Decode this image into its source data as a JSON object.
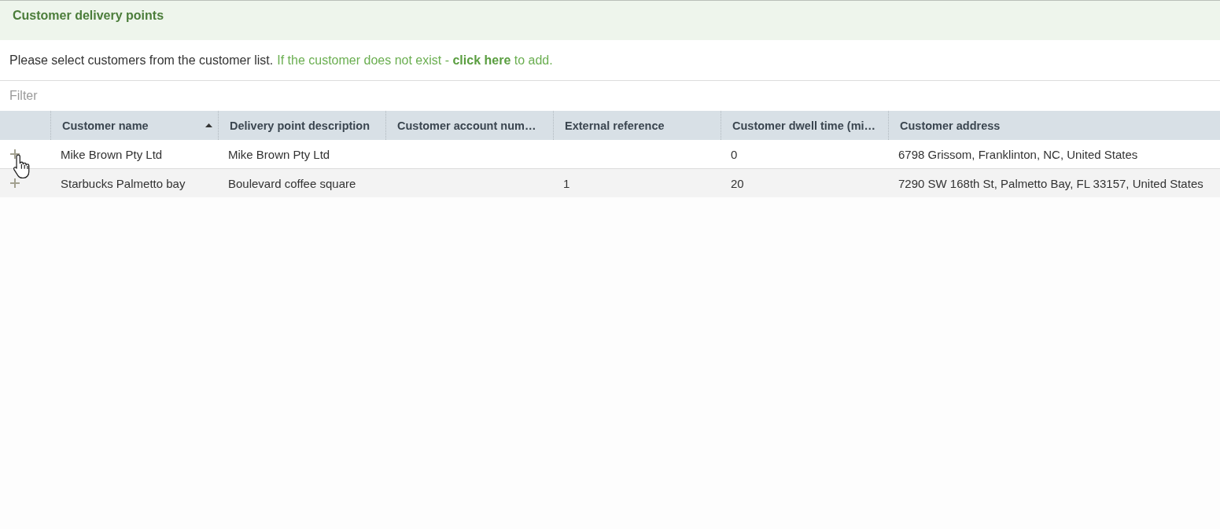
{
  "panel": {
    "title": "Customer delivery points"
  },
  "message": {
    "text": "Please select customers from the customer list.",
    "hint_before": "If the customer does not exist -",
    "link": "click here",
    "hint_after": "to add."
  },
  "filter": {
    "placeholder": "Filter"
  },
  "table": {
    "columns": [
      {
        "label": "Customer name",
        "sorted": true
      },
      {
        "label": "Delivery point description",
        "sorted": false
      },
      {
        "label": "Customer account num…",
        "sorted": false
      },
      {
        "label": "External reference",
        "sorted": false
      },
      {
        "label": "Customer dwell time (mi…",
        "sorted": false
      },
      {
        "label": "Customer address",
        "sorted": false
      }
    ],
    "rows": [
      {
        "expanded": false,
        "cells": [
          {
            "text": "Mike Brown Pty Ltd"
          },
          {
            "text": "Mike Brown Pty Ltd"
          },
          {},
          {},
          {
            "text": "0"
          },
          {
            "text": "6798 Grissom, Franklinton, NC, United States"
          }
        ]
      },
      {
        "expanded": false,
        "cells": [
          {
            "text": "Starbucks Palmetto bay"
          },
          {
            "text": "Boulevard coffee square"
          },
          {},
          {
            "text": "1"
          },
          {
            "text": "20"
          },
          {
            "text": "7290 SW 168th St, Palmetto Bay, FL 33157, United States"
          }
        ]
      }
    ]
  }
}
